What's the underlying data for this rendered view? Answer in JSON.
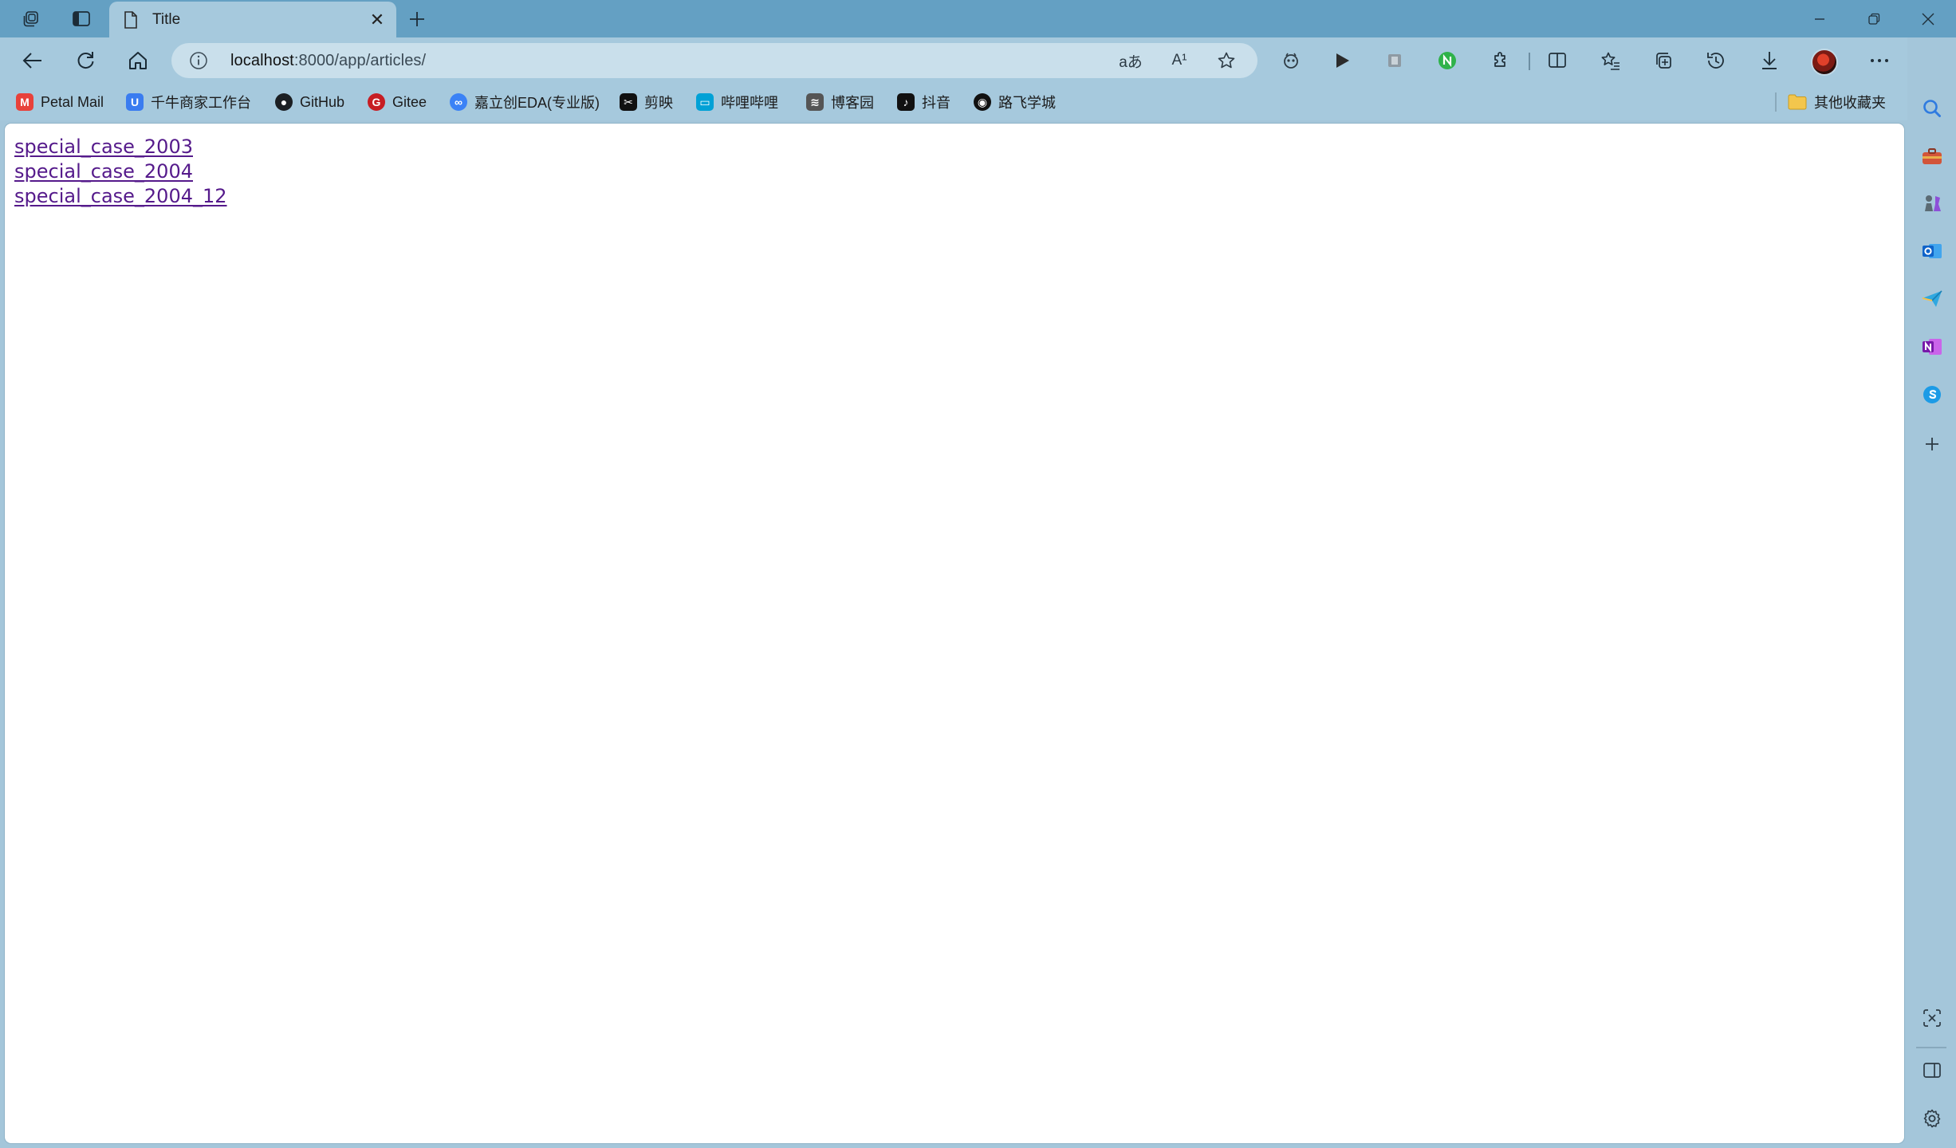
{
  "tab": {
    "title": "Title",
    "close_glyph": "✕"
  },
  "address_bar": {
    "host": "localhost",
    "rest": ":8000/app/articles/"
  },
  "toolbar": {
    "translate_label": "aあ",
    "read_aloud_label": "A¹"
  },
  "bookmarks": [
    {
      "label": "Petal Mail",
      "icon": "petal-mail-icon",
      "color": "#e8413a",
      "glyph": "M"
    },
    {
      "label": "千牛商家工作台",
      "icon": "qianniu-icon",
      "color": "#3a7cf0",
      "glyph": "U"
    },
    {
      "label": "GitHub",
      "icon": "github-icon",
      "color": "#1b1f23",
      "glyph": "●"
    },
    {
      "label": "Gitee",
      "icon": "gitee-icon",
      "color": "#c71d23",
      "glyph": "G"
    },
    {
      "label": "嘉立创EDA(专业版)",
      "icon": "jlceda-icon",
      "color": "#3b82f6",
      "glyph": "∞"
    },
    {
      "label": "剪映",
      "icon": "jianying-icon",
      "color": "#111111",
      "glyph": "✂"
    },
    {
      "label": "哔哩哔哩",
      "icon": "bilibili-icon",
      "color": "#00a1d6",
      "glyph": "▭"
    },
    {
      "label": "博客园",
      "icon": "cnblogs-icon",
      "color": "#555555",
      "glyph": "≋"
    },
    {
      "label": "抖音",
      "icon": "douyin-icon",
      "color": "#111111",
      "glyph": "♪"
    },
    {
      "label": "路飞学城",
      "icon": "luffy-icon",
      "color": "#111111",
      "glyph": "◉"
    }
  ],
  "other_favorites": "其他收藏夹",
  "page": {
    "links": [
      "special_case_2003",
      "special_case_2004",
      "special_case_2004_12"
    ]
  },
  "colors": {
    "frame": "#64a0c3",
    "toolbar": "#a6c9dd",
    "link_visited": "#551a8b"
  }
}
